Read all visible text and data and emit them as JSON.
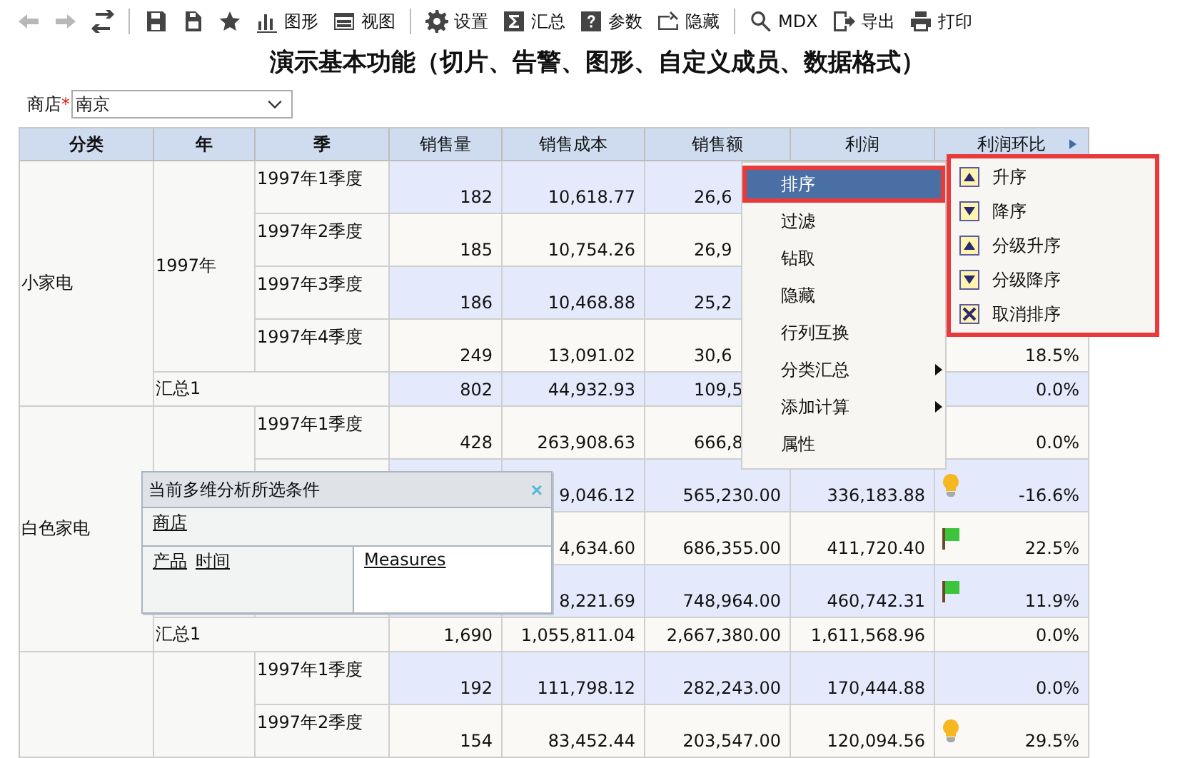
{
  "toolbar": {
    "groups": [
      [
        {
          "kind": "back",
          "disabled": true
        },
        {
          "kind": "forward",
          "disabled": true
        },
        {
          "kind": "refresh",
          "disabled": false
        }
      ],
      [
        {
          "kind": "save",
          "disabled": false
        },
        {
          "kind": "save-as",
          "disabled": false
        },
        {
          "kind": "star",
          "disabled": false
        },
        {
          "kind": "chart",
          "label": "图形",
          "disabled": false
        },
        {
          "kind": "view",
          "label": "视图",
          "disabled": false
        }
      ],
      [
        {
          "kind": "gear",
          "label": "设置",
          "disabled": false
        },
        {
          "kind": "sigma",
          "label": "汇总",
          "disabled": false
        },
        {
          "kind": "help",
          "label": "参数",
          "disabled": false
        },
        {
          "kind": "hide",
          "label": "隐藏",
          "disabled": false
        }
      ],
      [
        {
          "kind": "search",
          "label": "MDX",
          "disabled": false
        },
        {
          "kind": "export",
          "label": "导出",
          "disabled": false
        },
        {
          "kind": "print",
          "label": "打印",
          "disabled": false
        }
      ]
    ]
  },
  "title": "演示基本功能（切片、告警、图形、自定义成员、数据格式）",
  "filter": {
    "label": "商店",
    "required_mark": "*",
    "value": "南京"
  },
  "table": {
    "columns": [
      {
        "label": "分类"
      },
      {
        "label": "年"
      },
      {
        "label": "季"
      },
      {
        "label": "销售量"
      },
      {
        "label": "销售成本"
      },
      {
        "label": "销售额"
      },
      {
        "label": "利润"
      },
      {
        "label": "利润环比",
        "menu": true
      }
    ],
    "groups": [
      {
        "category": "小家电",
        "year": "1997年",
        "quarters": [
          {
            "label": "1997年1季度",
            "cells": [
              "182",
              "10,618.77",
              {
                "partial": "26,6"
              },
              null,
              null
            ]
          },
          {
            "label": "1997年2季度",
            "cells": [
              "185",
              "10,754.26",
              {
                "partial": "26,9"
              },
              null,
              null
            ]
          },
          {
            "label": "1997年3季度",
            "cells": [
              "186",
              "10,468.88",
              {
                "partial": "25,2"
              },
              null,
              null
            ]
          },
          {
            "label": "1997年4季度",
            "cells": [
              "249",
              "13,091.02",
              {
                "partial": "30,6"
              },
              null,
              "18.5%"
            ]
          }
        ],
        "subtotal": {
          "label": "汇总1",
          "cells": [
            "802",
            "44,932.93",
            {
              "partial": "109,5"
            },
            null,
            "0.0%"
          ]
        }
      },
      {
        "category": "白色家电",
        "quarters": [
          {
            "label": "1997年1季度",
            "cells": [
              "428",
              "263,908.63",
              {
                "partial": "666,8"
              },
              null,
              "0.0%"
            ]
          },
          {
            "cells": [
              null,
              "9,046.12",
              "565,230.00",
              "336,183.88",
              "-16.6%"
            ],
            "alert": {
              "kind": "bulb"
            }
          },
          {
            "cells": [
              null,
              "4,634.60",
              "686,355.00",
              "411,720.40",
              "22.5%"
            ],
            "alert": {
              "kind": "flag"
            }
          },
          {
            "cells": [
              null,
              "8,221.69",
              "748,964.00",
              "460,742.31",
              "11.9%"
            ],
            "alert": {
              "kind": "flag"
            }
          }
        ],
        "subtotal": {
          "label": "汇总1",
          "cells": [
            "1,690",
            "1,055,811.04",
            "2,667,380.00",
            "1,611,568.96",
            "0.0%"
          ]
        }
      },
      {
        "quarters": [
          {
            "label": "1997年1季度",
            "cells": [
              "192",
              "111,798.12",
              "282,243.00",
              "170,444.88",
              "0.0%"
            ]
          },
          {
            "label": "1997年2季度",
            "cells": [
              "154",
              "83,452.44",
              "203,547.00",
              "120,094.56",
              "29.5%"
            ],
            "alert": {
              "kind": "bulb"
            }
          }
        ]
      }
    ]
  },
  "context_menu": {
    "items": [
      {
        "label": "排序",
        "selected": true,
        "submenu": false
      },
      {
        "label": "过滤",
        "selected": false,
        "submenu": false
      },
      {
        "label": "钻取",
        "selected": false,
        "submenu": false
      },
      {
        "label": "隐藏",
        "selected": false,
        "submenu": false
      },
      {
        "label": "行列互换",
        "selected": false,
        "submenu": false
      },
      {
        "label": "分类汇总",
        "selected": false,
        "submenu": true
      },
      {
        "label": "添加计算",
        "selected": false,
        "submenu": true
      },
      {
        "label": "属性",
        "selected": false,
        "submenu": false
      }
    ]
  },
  "submenu": {
    "items": [
      {
        "kind": "up",
        "label": "升序"
      },
      {
        "kind": "down",
        "label": "降序"
      },
      {
        "kind": "up",
        "label": "分级升序"
      },
      {
        "kind": "down",
        "label": "分级降序"
      },
      {
        "kind": "cancel",
        "label": "取消排序"
      }
    ]
  },
  "conditions_panel": {
    "title": "当前多维分析所选条件",
    "close": "×",
    "slicer": [
      "商店"
    ],
    "rows": [
      "产品",
      "时间"
    ],
    "columns": [
      "Measures"
    ]
  }
}
